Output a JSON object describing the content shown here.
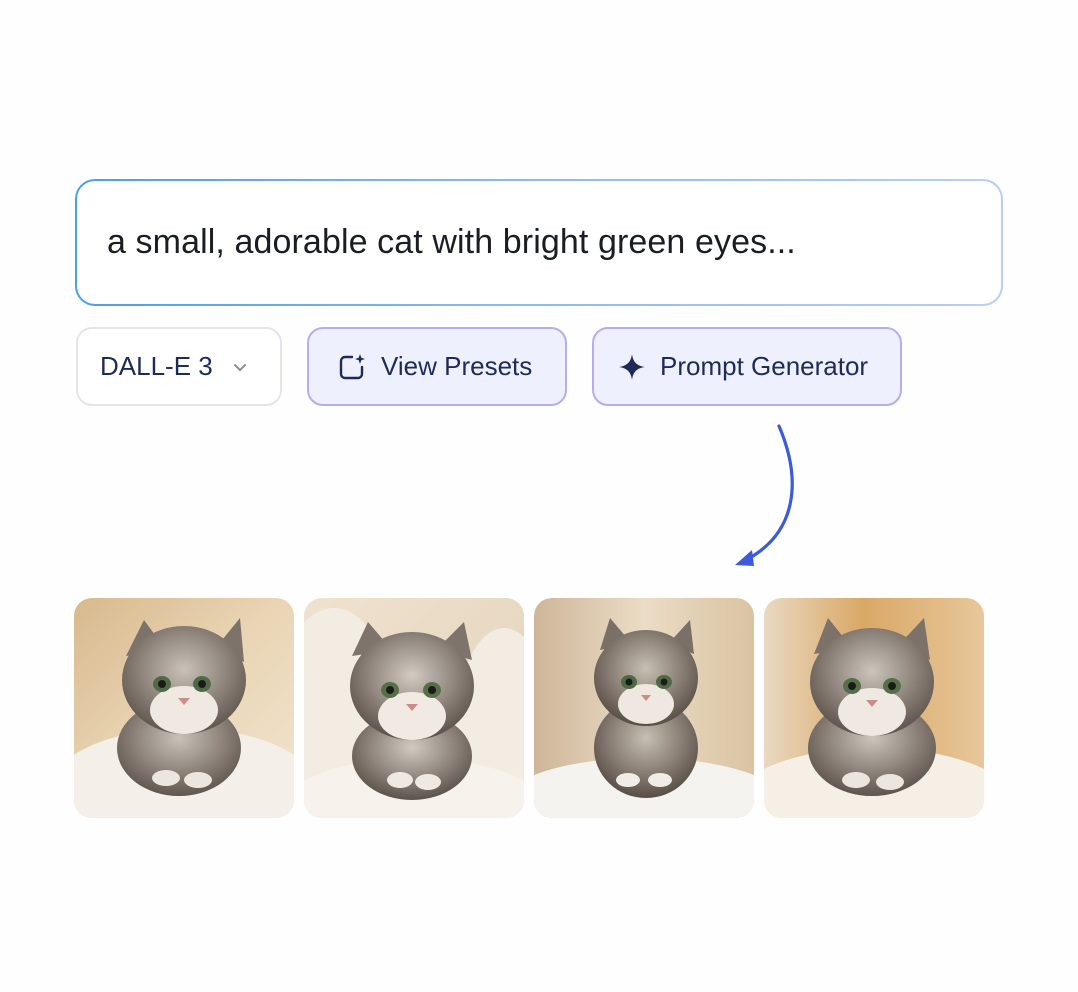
{
  "prompt": {
    "text": "a small, adorable cat with bright green eyes..."
  },
  "toolbar": {
    "model_label": "DALL-E 3",
    "presets_label": "View Presets",
    "generator_label": "Prompt Generator"
  },
  "gallery": {
    "images": [
      {
        "icon": "kitten-image",
        "variant": "warm-left"
      },
      {
        "icon": "kitten-image",
        "variant": "cream-blanket"
      },
      {
        "icon": "kitten-image",
        "variant": "soft-light"
      },
      {
        "icon": "kitten-image",
        "variant": "warm-right"
      }
    ]
  },
  "colors": {
    "accent": "#3b5bdb",
    "button_bg": "#eef1fd",
    "button_border": "#b8acf0",
    "text_dark": "#1f2b57"
  }
}
